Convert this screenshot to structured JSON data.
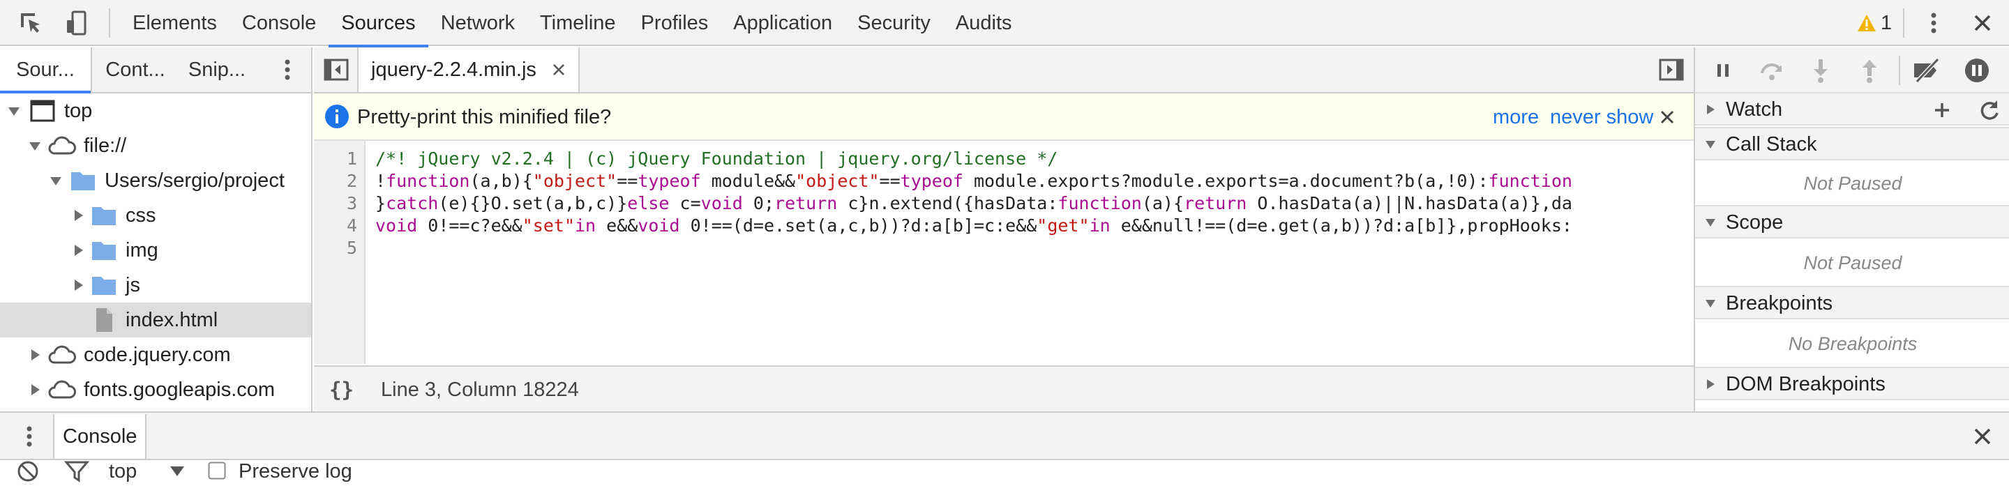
{
  "toolbar": {
    "inspect_icon": "cursor-select-icon",
    "device_icon": "device-mode-icon",
    "tabs": [
      {
        "label": "Elements"
      },
      {
        "label": "Console"
      },
      {
        "label": "Sources",
        "active": true
      },
      {
        "label": "Network"
      },
      {
        "label": "Timeline"
      },
      {
        "label": "Profiles"
      },
      {
        "label": "Application"
      },
      {
        "label": "Security"
      },
      {
        "label": "Audits"
      }
    ],
    "warning_count": "1",
    "warning_color": "#f2b400",
    "accent_color": "#3e82f7"
  },
  "navigator": {
    "tabs": [
      {
        "label": "Sour...",
        "active": true
      },
      {
        "label": "Cont..."
      },
      {
        "label": "Snip..."
      }
    ],
    "tree": [
      {
        "label": "top",
        "icon": "frame-icon",
        "expanded": true
      },
      {
        "label": "file://",
        "icon": "cloud-icon",
        "expanded": true
      },
      {
        "label": "Users/sergio/project",
        "icon": "folder-icon",
        "expanded": true
      },
      {
        "label": "css",
        "icon": "folder-icon",
        "expanded": false
      },
      {
        "label": "img",
        "icon": "folder-icon",
        "expanded": false
      },
      {
        "label": "js",
        "icon": "folder-icon",
        "expanded": false
      },
      {
        "label": "index.html",
        "icon": "file-icon",
        "selected": true
      },
      {
        "label": "code.jquery.com",
        "icon": "cloud-icon",
        "expanded": false
      },
      {
        "label": "fonts.googleapis.com",
        "icon": "cloud-icon",
        "expanded": false
      }
    ],
    "folder_color": "#7dace9"
  },
  "editor": {
    "file_tab": "jquery-2.2.4.min.js",
    "infobar": {
      "message": "Pretty-print this minified file?",
      "more": "more",
      "never_show": "never show"
    },
    "line_numbers": [
      "1",
      "2",
      "3",
      "4",
      "5"
    ],
    "lines": [
      [
        {
          "t": "/*! jQuery v2.2.4 | (c) jQuery Foundation | jquery.org/license */",
          "c": "cm"
        }
      ],
      [
        {
          "t": "!",
          "c": ""
        },
        {
          "t": "function",
          "c": "kw"
        },
        {
          "t": "(a,b){",
          "c": ""
        },
        {
          "t": "\"object\"",
          "c": "st"
        },
        {
          "t": "==",
          "c": ""
        },
        {
          "t": "typeof",
          "c": "kw"
        },
        {
          "t": " module&&",
          "c": ""
        },
        {
          "t": "\"object\"",
          "c": "st"
        },
        {
          "t": "==",
          "c": ""
        },
        {
          "t": "typeof",
          "c": "kw"
        },
        {
          "t": " module.exports?module.exports=a.document?b(a,!0):",
          "c": ""
        },
        {
          "t": "function",
          "c": "kw"
        }
      ],
      [
        {
          "t": "}",
          "c": ""
        },
        {
          "t": "catch",
          "c": "kw"
        },
        {
          "t": "(e){}O.set(a,b,c)}",
          "c": ""
        },
        {
          "t": "else",
          "c": "kw"
        },
        {
          "t": " c=",
          "c": ""
        },
        {
          "t": "void",
          "c": "kw"
        },
        {
          "t": " 0;",
          "c": ""
        },
        {
          "t": "return",
          "c": "kw"
        },
        {
          "t": " c}n.extend({hasData:",
          "c": ""
        },
        {
          "t": "function",
          "c": "kw"
        },
        {
          "t": "(a){",
          "c": ""
        },
        {
          "t": "return",
          "c": "kw"
        },
        {
          "t": " O.hasData(a)||N.hasData(a)},da",
          "c": ""
        }
      ],
      [
        {
          "t": "void",
          "c": "kw"
        },
        {
          "t": " 0!==c?e&&",
          "c": ""
        },
        {
          "t": "\"set\"",
          "c": "st"
        },
        {
          "t": "in",
          "c": "kw"
        },
        {
          "t": " e&&",
          "c": ""
        },
        {
          "t": "void",
          "c": "kw"
        },
        {
          "t": " 0!==(d=e.set(a,c,b))?d:a[b]=c:e&&",
          "c": ""
        },
        {
          "t": "\"get\"",
          "c": "st"
        },
        {
          "t": "in",
          "c": "kw"
        },
        {
          "t": " e&&null!==(d=e.get(a,b))?d:a[b]},propHooks:",
          "c": ""
        }
      ],
      []
    ],
    "status": {
      "braces": "{}",
      "position": "Line 3, Column 18224"
    }
  },
  "debugger": {
    "toolbar_icons": [
      "pause-icon",
      "step-over-icon",
      "step-into-icon",
      "step-out-icon",
      "deactivate-breakpoints-icon",
      "pause-on-exceptions-icon"
    ],
    "panes": [
      {
        "title": "Watch",
        "expanded": false
      },
      {
        "title": "Call Stack",
        "expanded": true,
        "body": "Not Paused"
      },
      {
        "title": "Scope",
        "expanded": true,
        "body": "Not Paused"
      },
      {
        "title": "Breakpoints",
        "expanded": true,
        "body": "No Breakpoints"
      },
      {
        "title": "DOM Breakpoints",
        "expanded": false
      }
    ]
  },
  "drawer": {
    "tab": "Console",
    "context": "top",
    "preserve_log": "Preserve log"
  }
}
